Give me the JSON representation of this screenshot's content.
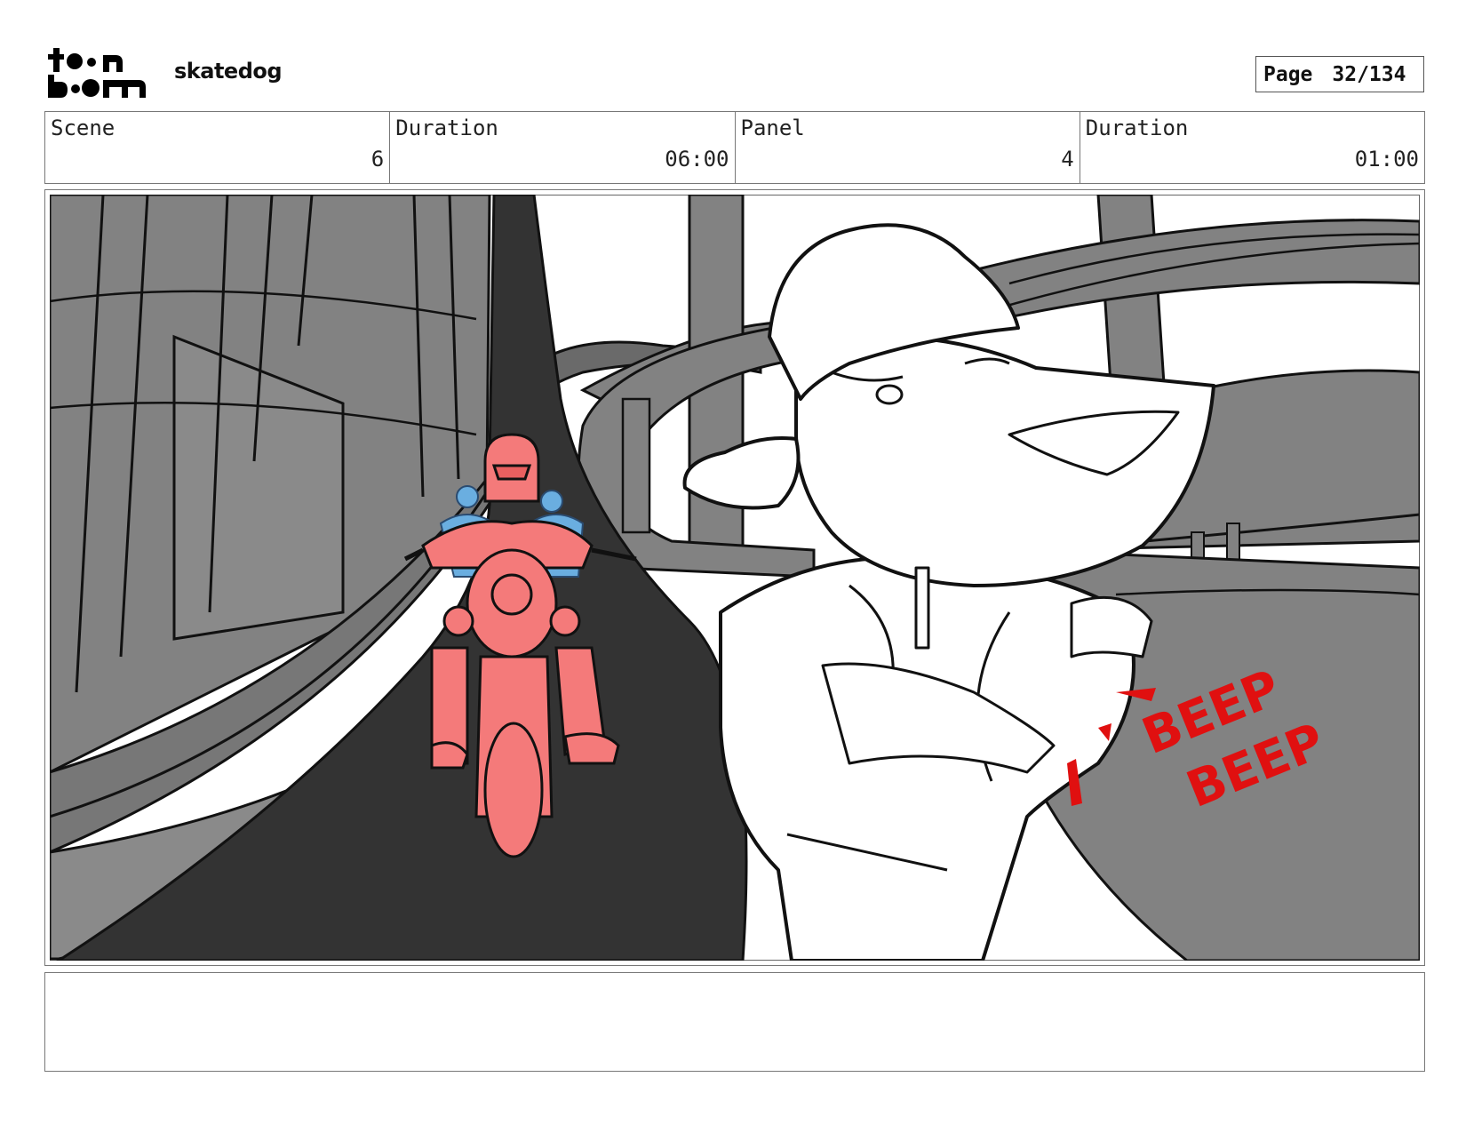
{
  "header": {
    "logo_text": "toon boom",
    "project_title": "skatedog",
    "page_label": "Page",
    "page_number": "32/134"
  },
  "info": {
    "scene_label": "Scene",
    "scene_value": "6",
    "scene_duration_label": "Duration",
    "scene_duration_value": "06:00",
    "panel_label": "Panel",
    "panel_value": "4",
    "panel_duration_label": "Duration",
    "panel_duration_value": "01:00"
  },
  "artwork": {
    "sound_effect_line1": "BEEP",
    "sound_effect_line2": "BEEP",
    "colors": {
      "road": "#333333",
      "walls": "#828282",
      "rider": "#f47a7a",
      "background_riders": "#6aaee0",
      "sfx": "#e01010"
    }
  },
  "notes": {
    "text": ""
  }
}
